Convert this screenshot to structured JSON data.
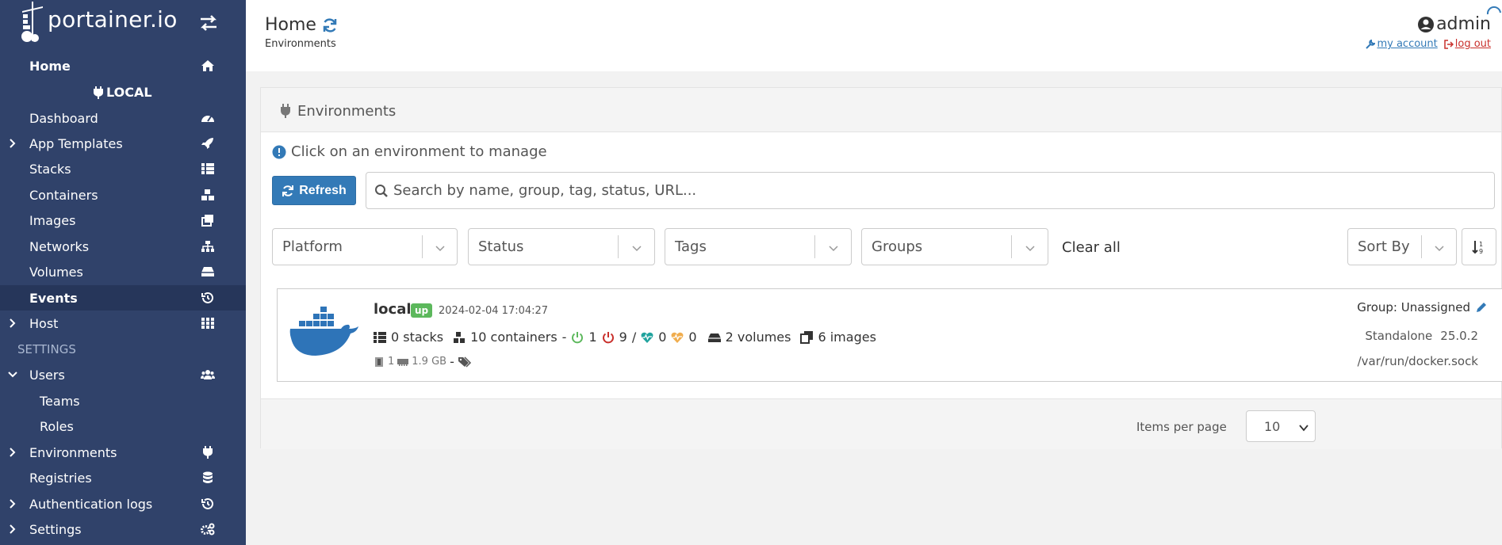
{
  "brand": {
    "name": "portainer.io"
  },
  "sidebar": {
    "home": "Home",
    "endpoint": "LOCAL",
    "items": [
      {
        "label": "Dashboard"
      },
      {
        "label": "App Templates"
      },
      {
        "label": "Stacks"
      },
      {
        "label": "Containers"
      },
      {
        "label": "Images"
      },
      {
        "label": "Networks"
      },
      {
        "label": "Volumes"
      },
      {
        "label": "Events"
      },
      {
        "label": "Host"
      }
    ],
    "settings_header": "SETTINGS",
    "settings_items": [
      {
        "label": "Users"
      },
      {
        "label": "Teams"
      },
      {
        "label": "Roles"
      },
      {
        "label": "Environments"
      },
      {
        "label": "Registries"
      },
      {
        "label": "Authentication logs"
      },
      {
        "label": "Settings"
      }
    ]
  },
  "header": {
    "title": "Home",
    "breadcrumb": "Environments",
    "username": "admin",
    "my_account": "my account",
    "log_out": "log out"
  },
  "panel": {
    "title": "Environments",
    "hint": "Click on an environment to manage",
    "refresh_label": "Refresh",
    "search_placeholder": "Search by name, group, tag, status, URL...",
    "filters": {
      "platform": "Platform",
      "status": "Status",
      "tags": "Tags",
      "groups": "Groups",
      "clear_all": "Clear all",
      "sort_by": "Sort By"
    }
  },
  "environment": {
    "name": "local",
    "status": "up",
    "timestamp": "2024-02-04 17:04:27",
    "stacks": "0 stacks",
    "containers": "10 containers",
    "dash": "-",
    "running": "1",
    "stopped": "9",
    "slash": "/",
    "healthy": "0",
    "unhealthy": "0",
    "volumes": "2 volumes",
    "images": "6 images",
    "cpu": "1",
    "memory": "1.9 GB",
    "meta_dash": "-",
    "group": "Group: Unassigned",
    "platform_type": "Standalone",
    "version": "25.0.2",
    "url": "/var/run/docker.sock"
  },
  "pagination": {
    "items_per_page_label": "Items per page",
    "items_per_page": "10"
  },
  "colors": {
    "sidebar_bg": "#30426a",
    "primary": "#337ab7",
    "success": "#5cb85c",
    "danger": "#c9302c",
    "warning": "#f0ad4e",
    "healthy": "#20a39e"
  }
}
